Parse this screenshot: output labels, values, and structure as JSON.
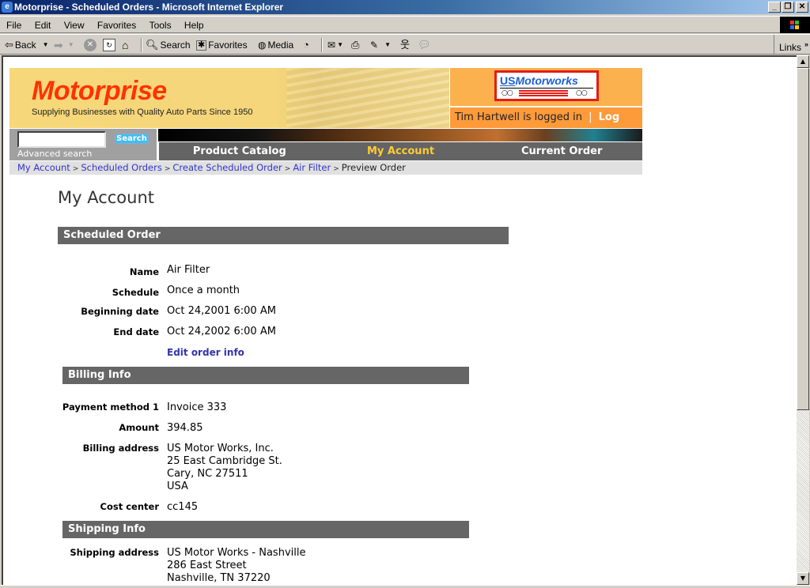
{
  "window": {
    "title": "Motorprise - Scheduled Orders - Microsoft Internet Explorer",
    "controls": [
      "minimize",
      "restore",
      "close"
    ]
  },
  "menubar": {
    "items": [
      "File",
      "Edit",
      "View",
      "Favorites",
      "Tools",
      "Help"
    ]
  },
  "toolbar": {
    "back_label": "Back",
    "search_label": "Search",
    "favorites_label": "Favorites",
    "media_label": "Media",
    "links_label": "Links"
  },
  "site": {
    "brand": "Motorprise",
    "tagline": "Supplying Businesses with Quality Auto Parts Since 1950",
    "partner_logo": {
      "us": "US",
      "name": "Motorworks"
    },
    "login_text": "Tim Hartwell is logged in",
    "login_separator": "|",
    "logout_label": "Log out",
    "search": {
      "value": "",
      "placeholder": "",
      "button_label": "Search",
      "advanced_label": "Advanced search"
    },
    "nav": [
      {
        "label": "Product Catalog",
        "active": false
      },
      {
        "label": "My Account",
        "active": true
      },
      {
        "label": "Current Order",
        "active": false
      }
    ],
    "colors": {
      "brand_red": "#ff3300",
      "nav_active": "#ffcc33",
      "nav_bg": "#646464",
      "link_blue": "#3333cc",
      "section_bar": "#666666",
      "banner_yellow": "#f6d77a",
      "login_orange": "#fd9a3a"
    }
  },
  "breadcrumb": {
    "links": [
      "My Account",
      "Scheduled Orders",
      "Create Scheduled Order",
      "Air Filter"
    ],
    "separator": ">",
    "current": "Preview Order"
  },
  "main": {
    "page_title": "My Account",
    "scheduled_order": {
      "heading": "Scheduled Order",
      "fields": [
        {
          "label": "Name",
          "value": "Air Filter"
        },
        {
          "label": "Schedule",
          "value": "Once a month"
        },
        {
          "label": "Beginning date",
          "value": "Oct 24,2001 6:00 AM"
        },
        {
          "label": "End date",
          "value": "Oct 24,2002 6:00 AM"
        }
      ],
      "edit_link": "Edit order info"
    },
    "billing": {
      "heading": "Billing Info",
      "payment_method_label": "Payment method 1",
      "payment_method_value": "Invoice 333",
      "amount_label": "Amount",
      "amount_value": "394.85",
      "address_label": "Billing address",
      "address_lines": [
        "US Motor Works, Inc.",
        "25 East Cambridge St.",
        "Cary, NC 27511",
        "USA"
      ],
      "cost_center_label": "Cost center",
      "cost_center_value": "cc145"
    },
    "shipping": {
      "heading": "Shipping Info",
      "address_label": "Shipping address",
      "address_lines": [
        "US Motor Works - Nashville",
        "286 East Street",
        "Nashville, TN 37220"
      ]
    }
  }
}
